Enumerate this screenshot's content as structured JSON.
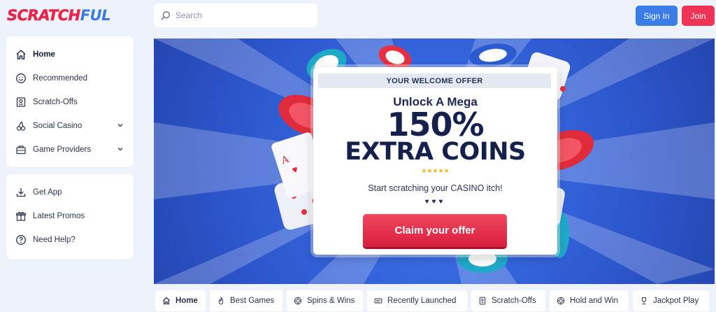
{
  "brand": {
    "logo_part1": "SCRATCH",
    "logo_part2": "FUL",
    "logo_colors": [
      "#e8264b",
      "#3b7be6"
    ]
  },
  "header": {
    "search_placeholder": "Search",
    "signin_label": "Sign In",
    "join_label": "Join"
  },
  "sidebar": {
    "primary": [
      {
        "label": "Home",
        "icon": "home-icon",
        "active": true
      },
      {
        "label": "Recommended",
        "icon": "smiley-icon"
      },
      {
        "label": "Scratch-Offs",
        "icon": "ticket-icon"
      },
      {
        "label": "Social Casino",
        "icon": "cherries-icon",
        "expandable": true
      },
      {
        "label": "Game Providers",
        "icon": "providers-icon",
        "expandable": true
      }
    ],
    "secondary": [
      {
        "label": "Get App",
        "icon": "download-icon"
      },
      {
        "label": "Latest Promos",
        "icon": "gift-icon"
      },
      {
        "label": "Need Help?",
        "icon": "help-icon"
      }
    ]
  },
  "hero": {
    "offer_header": "YOUR WELCOME OFFER",
    "subtitle": "Unlock A Mega",
    "headline_1": "150%",
    "headline_2": "EXTRA COINS",
    "stars": "★★★★★",
    "tagline": "Start scratching your CASINO itch!",
    "dots": "♥♥♥",
    "cta_label": "Claim your offer"
  },
  "categories": [
    {
      "label": "Home",
      "icon": "home-icon",
      "active": true
    },
    {
      "label": "Best Games",
      "icon": "flame-icon"
    },
    {
      "label": "Spins & Wins",
      "icon": "chip-icon"
    },
    {
      "label": "Recently Launched",
      "icon": "ticket-icon"
    },
    {
      "label": "Scratch-Offs",
      "icon": "card-icon"
    },
    {
      "label": "Hold and Win",
      "icon": "chip-icon"
    },
    {
      "label": "Jackpot Play",
      "icon": "trophy-icon"
    }
  ],
  "colors": {
    "accent_blue": "#3a7de8",
    "accent_red": "#ee3356",
    "page_bg": "#eef3fb"
  }
}
